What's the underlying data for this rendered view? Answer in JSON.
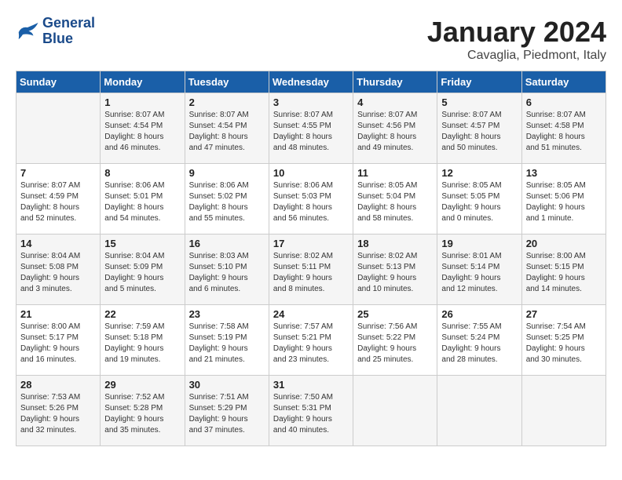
{
  "logo": {
    "line1": "General",
    "line2": "Blue"
  },
  "title": "January 2024",
  "subtitle": "Cavaglia, Piedmont, Italy",
  "days_header": [
    "Sunday",
    "Monday",
    "Tuesday",
    "Wednesday",
    "Thursday",
    "Friday",
    "Saturday"
  ],
  "weeks": [
    [
      {
        "day": "",
        "info": ""
      },
      {
        "day": "1",
        "info": "Sunrise: 8:07 AM\nSunset: 4:54 PM\nDaylight: 8 hours\nand 46 minutes."
      },
      {
        "day": "2",
        "info": "Sunrise: 8:07 AM\nSunset: 4:54 PM\nDaylight: 8 hours\nand 47 minutes."
      },
      {
        "day": "3",
        "info": "Sunrise: 8:07 AM\nSunset: 4:55 PM\nDaylight: 8 hours\nand 48 minutes."
      },
      {
        "day": "4",
        "info": "Sunrise: 8:07 AM\nSunset: 4:56 PM\nDaylight: 8 hours\nand 49 minutes."
      },
      {
        "day": "5",
        "info": "Sunrise: 8:07 AM\nSunset: 4:57 PM\nDaylight: 8 hours\nand 50 minutes."
      },
      {
        "day": "6",
        "info": "Sunrise: 8:07 AM\nSunset: 4:58 PM\nDaylight: 8 hours\nand 51 minutes."
      }
    ],
    [
      {
        "day": "7",
        "info": "Sunrise: 8:07 AM\nSunset: 4:59 PM\nDaylight: 8 hours\nand 52 minutes."
      },
      {
        "day": "8",
        "info": "Sunrise: 8:06 AM\nSunset: 5:01 PM\nDaylight: 8 hours\nand 54 minutes."
      },
      {
        "day": "9",
        "info": "Sunrise: 8:06 AM\nSunset: 5:02 PM\nDaylight: 8 hours\nand 55 minutes."
      },
      {
        "day": "10",
        "info": "Sunrise: 8:06 AM\nSunset: 5:03 PM\nDaylight: 8 hours\nand 56 minutes."
      },
      {
        "day": "11",
        "info": "Sunrise: 8:05 AM\nSunset: 5:04 PM\nDaylight: 8 hours\nand 58 minutes."
      },
      {
        "day": "12",
        "info": "Sunrise: 8:05 AM\nSunset: 5:05 PM\nDaylight: 9 hours\nand 0 minutes."
      },
      {
        "day": "13",
        "info": "Sunrise: 8:05 AM\nSunset: 5:06 PM\nDaylight: 9 hours\nand 1 minute."
      }
    ],
    [
      {
        "day": "14",
        "info": "Sunrise: 8:04 AM\nSunset: 5:08 PM\nDaylight: 9 hours\nand 3 minutes."
      },
      {
        "day": "15",
        "info": "Sunrise: 8:04 AM\nSunset: 5:09 PM\nDaylight: 9 hours\nand 5 minutes."
      },
      {
        "day": "16",
        "info": "Sunrise: 8:03 AM\nSunset: 5:10 PM\nDaylight: 9 hours\nand 6 minutes."
      },
      {
        "day": "17",
        "info": "Sunrise: 8:02 AM\nSunset: 5:11 PM\nDaylight: 9 hours\nand 8 minutes."
      },
      {
        "day": "18",
        "info": "Sunrise: 8:02 AM\nSunset: 5:13 PM\nDaylight: 9 hours\nand 10 minutes."
      },
      {
        "day": "19",
        "info": "Sunrise: 8:01 AM\nSunset: 5:14 PM\nDaylight: 9 hours\nand 12 minutes."
      },
      {
        "day": "20",
        "info": "Sunrise: 8:00 AM\nSunset: 5:15 PM\nDaylight: 9 hours\nand 14 minutes."
      }
    ],
    [
      {
        "day": "21",
        "info": "Sunrise: 8:00 AM\nSunset: 5:17 PM\nDaylight: 9 hours\nand 16 minutes."
      },
      {
        "day": "22",
        "info": "Sunrise: 7:59 AM\nSunset: 5:18 PM\nDaylight: 9 hours\nand 19 minutes."
      },
      {
        "day": "23",
        "info": "Sunrise: 7:58 AM\nSunset: 5:19 PM\nDaylight: 9 hours\nand 21 minutes."
      },
      {
        "day": "24",
        "info": "Sunrise: 7:57 AM\nSunset: 5:21 PM\nDaylight: 9 hours\nand 23 minutes."
      },
      {
        "day": "25",
        "info": "Sunrise: 7:56 AM\nSunset: 5:22 PM\nDaylight: 9 hours\nand 25 minutes."
      },
      {
        "day": "26",
        "info": "Sunrise: 7:55 AM\nSunset: 5:24 PM\nDaylight: 9 hours\nand 28 minutes."
      },
      {
        "day": "27",
        "info": "Sunrise: 7:54 AM\nSunset: 5:25 PM\nDaylight: 9 hours\nand 30 minutes."
      }
    ],
    [
      {
        "day": "28",
        "info": "Sunrise: 7:53 AM\nSunset: 5:26 PM\nDaylight: 9 hours\nand 32 minutes."
      },
      {
        "day": "29",
        "info": "Sunrise: 7:52 AM\nSunset: 5:28 PM\nDaylight: 9 hours\nand 35 minutes."
      },
      {
        "day": "30",
        "info": "Sunrise: 7:51 AM\nSunset: 5:29 PM\nDaylight: 9 hours\nand 37 minutes."
      },
      {
        "day": "31",
        "info": "Sunrise: 7:50 AM\nSunset: 5:31 PM\nDaylight: 9 hours\nand 40 minutes."
      },
      {
        "day": "",
        "info": ""
      },
      {
        "day": "",
        "info": ""
      },
      {
        "day": "",
        "info": ""
      }
    ]
  ]
}
